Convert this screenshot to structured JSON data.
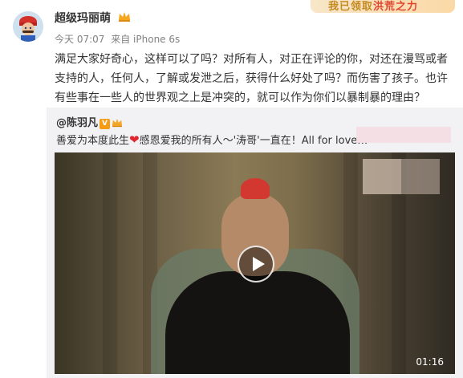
{
  "sticker": {
    "text_prefix": "我已领取",
    "text_highlight": "洪荒之力",
    "icon": "sticker-icon"
  },
  "post": {
    "username": "超级玛丽萌",
    "meta": {
      "time": "今天 07:07",
      "source": "来自 iPhone 6s"
    },
    "body_lines": [
      "满足大家好奇心，这样可以了吗？对所有人，对正在评论的你，对还在漫骂或者",
      "支持的人，任何人，了解或发泄之后，获得什么好处了吗？而伤害了孩子。也许",
      "有些事在一些人的世界观之上是冲突的，就可以作为你们以暴制暴的理由？"
    ]
  },
  "repost": {
    "user": "@陈羽凡",
    "text_before": "善爱为本度此生",
    "heart": "❤",
    "text_after": "感恩爱我的所有人～'涛哥'一直在！All for love…"
  },
  "video": {
    "duration": "01:16",
    "play_icon": "play-icon"
  },
  "colors": {
    "accent_orange": "#f89b14",
    "repost_bg": "#f2f2f5",
    "heart_red": "#e0262e"
  }
}
